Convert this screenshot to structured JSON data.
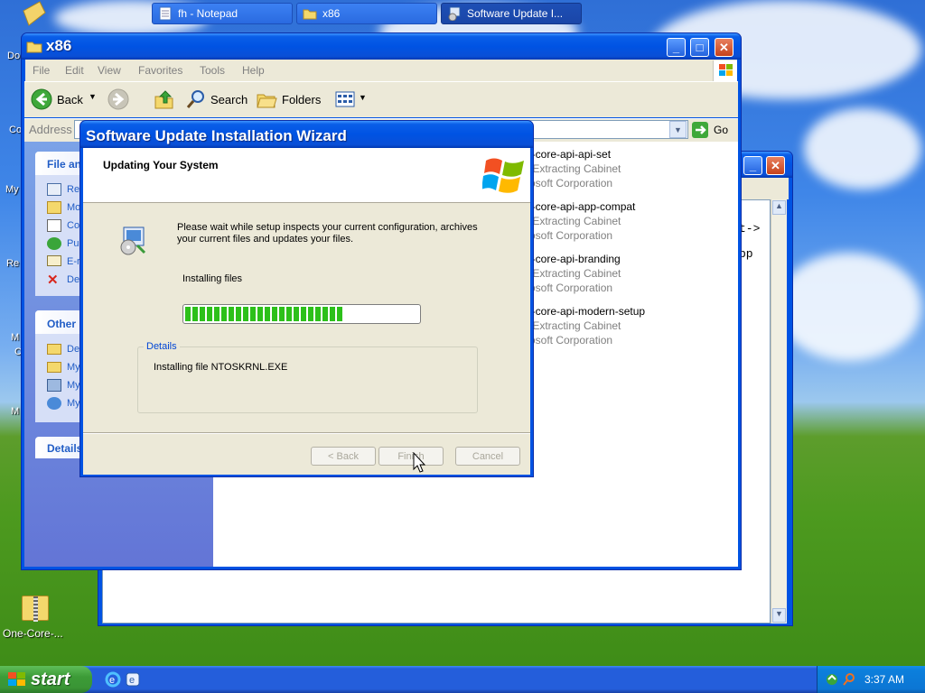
{
  "desktop": {
    "icons": [
      {
        "label": "Do"
      },
      {
        "label": "Co"
      },
      {
        "label": "My"
      },
      {
        "label": "Re"
      },
      {
        "label": "M"
      },
      {
        "label": "C"
      },
      {
        "label": "M"
      }
    ],
    "one_core_label": "One-Core-..."
  },
  "explorer": {
    "title": "x86",
    "menu": [
      "File",
      "Edit",
      "View",
      "Favorites",
      "Tools",
      "Help"
    ],
    "toolbar": {
      "back": "Back",
      "search": "Search",
      "folders": "Folders"
    },
    "address_label": "Address",
    "go_label": "Go",
    "tasks_header": "File an",
    "tasks": [
      "Re",
      "Mo",
      "Co",
      "Pu",
      "E-r",
      "De"
    ],
    "other_header": "Other",
    "other_places": [
      "De",
      "My",
      "My",
      "My"
    ],
    "details_header": "Details",
    "files": [
      {
        "name": "e-core-api-api-set",
        "type": "f-Extracting Cabinet",
        "company": "rosoft Corporation"
      },
      {
        "name": "e-core-api-app-compat",
        "type": "f-Extracting Cabinet",
        "company": "rosoft Corporation"
      },
      {
        "name": "e-core-api-branding",
        "type": "f-Extracting Cabinet",
        "company": "rosoft Corporation"
      },
      {
        "name": "e-core-api-modern-setup",
        "type": "f-Extracting Cabinet",
        "company": "rosoft Corporation"
      }
    ]
  },
  "notepad": {
    "text_line1": "t->",
    "text_line2": "pp"
  },
  "wizard": {
    "title": "Software Update Installation Wizard",
    "header": "Updating Your System",
    "description": "Please wait while setup inspects your current configuration, archives your current files and updates your files.",
    "status": "Installing files",
    "progress": 0.68,
    "details_label": "Details",
    "details_text": "Installing file NTOSKRNL.EXE",
    "buttons": {
      "back": "< Back",
      "finish": "Finish",
      "cancel": "Cancel"
    }
  },
  "taskbar": {
    "start": "start",
    "tasks": [
      {
        "label": "fh - Notepad"
      },
      {
        "label": "x86"
      },
      {
        "label": "Software Update I..."
      }
    ],
    "clock": "3:37 AM"
  },
  "colors": {
    "accent": "#0053e3",
    "progress": "#22b614",
    "link": "#215dc6"
  }
}
